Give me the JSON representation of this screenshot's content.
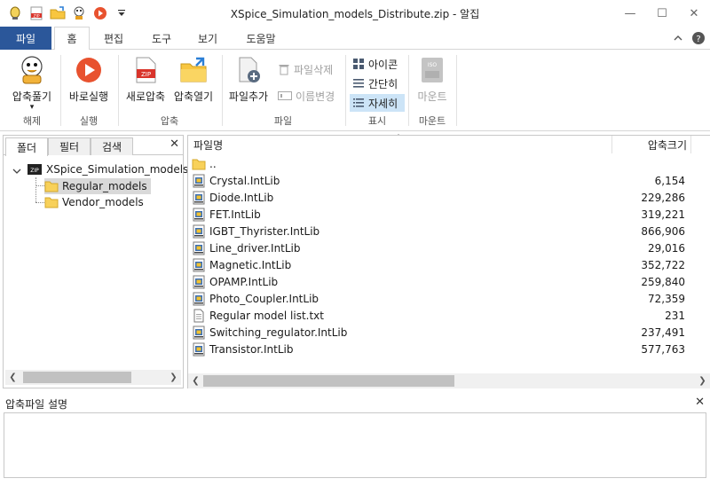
{
  "window": {
    "title": "XSpice_Simulation_models_Distribute.zip - 알집",
    "minimize": "—",
    "maximize": "☐",
    "close": "✕"
  },
  "quick_access": [
    "app-logo",
    "zip-file",
    "open-folder",
    "character",
    "play",
    "dropdown"
  ],
  "menu": {
    "file": "파일",
    "tabs": [
      "홈",
      "편집",
      "도구",
      "보기",
      "도움말"
    ],
    "active_tab": "홈"
  },
  "ribbon": {
    "extract": {
      "label": "압축풀기",
      "arrow": "▾",
      "group": "해제"
    },
    "run": {
      "label": "바로실행",
      "group": "실행"
    },
    "new_archive": {
      "label": "새로압축",
      "badge": "ZIP"
    },
    "open_archive": {
      "label": "압축열기"
    },
    "compress_group": "압축",
    "add_file": {
      "label": "파일추가"
    },
    "delete_file": {
      "label": "파일삭제"
    },
    "rename": {
      "label": "이름변경"
    },
    "file_group": "파일",
    "view_icon": {
      "label": "아이콘"
    },
    "view_simple": {
      "label": "간단히"
    },
    "view_detail": {
      "label": "자세히"
    },
    "display_group": "표시",
    "mount": {
      "label": "마운트",
      "badge": "ISO"
    },
    "mount_group": "마운트"
  },
  "left_pane": {
    "tabs": [
      "폴더",
      "필터",
      "검색"
    ],
    "close": "✕",
    "tree": {
      "root": "XSpice_Simulation_models_D",
      "root_badge": "ZIP",
      "children": [
        "Regular_models",
        "Vendor_models"
      ],
      "selected": "Regular_models"
    }
  },
  "file_list": {
    "columns": {
      "name": "파일명",
      "size": "압축크기"
    },
    "parent": "..",
    "files": [
      {
        "name": "Crystal.IntLib",
        "size": "6,154",
        "type": "intlib"
      },
      {
        "name": "Diode.IntLib",
        "size": "229,286",
        "type": "intlib"
      },
      {
        "name": "FET.IntLib",
        "size": "319,221",
        "type": "intlib"
      },
      {
        "name": "IGBT_Thyrister.IntLib",
        "size": "866,906",
        "type": "intlib"
      },
      {
        "name": "Line_driver.IntLib",
        "size": "29,016",
        "type": "intlib"
      },
      {
        "name": "Magnetic.IntLib",
        "size": "352,722",
        "type": "intlib"
      },
      {
        "name": "OPAMP.IntLib",
        "size": "259,840",
        "type": "intlib"
      },
      {
        "name": "Photo_Coupler.IntLib",
        "size": "72,359",
        "type": "intlib"
      },
      {
        "name": "Regular model list.txt",
        "size": "231",
        "type": "txt"
      },
      {
        "name": "Switching_regulator.IntLib",
        "size": "237,491",
        "type": "intlib"
      },
      {
        "name": "Transistor.IntLib",
        "size": "577,763",
        "type": "intlib"
      }
    ]
  },
  "description": {
    "title": "압축파일 설명",
    "close": "✕"
  },
  "colors": {
    "file_tab": "#2b579a",
    "selection": "#cce4f7",
    "run_red": "#e8522f",
    "folder_yellow": "#f8d15a"
  }
}
